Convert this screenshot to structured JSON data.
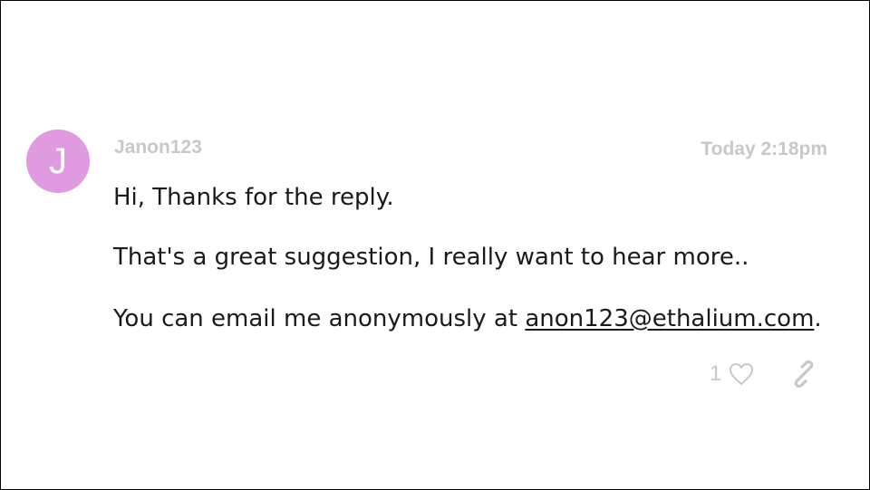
{
  "comment": {
    "avatar": {
      "initial": "J",
      "color": "#e09be0"
    },
    "author": "Janon123",
    "timestamp": "Today 2:18pm",
    "body": {
      "line1": "Hi, Thanks for the reply.",
      "line2": "That's a great suggestion, I really want to hear more..",
      "line3_prefix": "You can email me anonymously at ",
      "email": "anon123@ethalium.com",
      "line3_suffix": "."
    },
    "actions": {
      "like_count": "1",
      "like_icon": "heart-outline-icon",
      "link_icon": "chain-link-icon"
    },
    "meta_text_color": "#c8c8c8"
  }
}
